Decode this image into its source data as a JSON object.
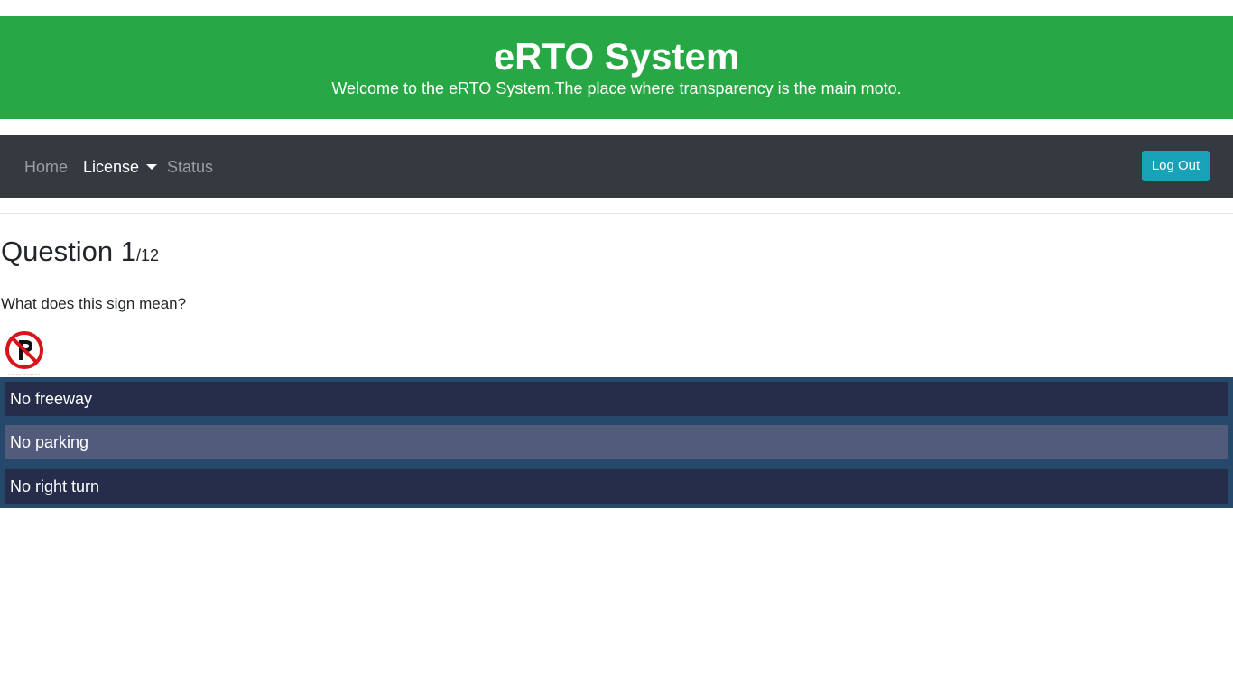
{
  "banner": {
    "title": "eRTO System",
    "subtitle": "Welcome to the eRTO System.The place where transparency is the main moto.",
    "background_color": "#28a745"
  },
  "navbar": {
    "items": [
      {
        "label": "Home"
      },
      {
        "label": "License",
        "has_dropdown": true,
        "active": true
      },
      {
        "label": "Status"
      }
    ],
    "logout_label": "Log Out",
    "background_color": "#343a40",
    "logout_color": "#17a2b8"
  },
  "question": {
    "label": "Question 1",
    "total": "/12",
    "text": "What does this sign mean?",
    "sign_icon": "no-parking-sign-icon"
  },
  "options": [
    {
      "label": "No freeway",
      "selected": false
    },
    {
      "label": "No parking",
      "selected": true
    },
    {
      "label": "No right turn",
      "selected": false
    }
  ],
  "colors": {
    "options_panel": "#26486b",
    "option_default": "#252d4a",
    "option_selected": "#525b7a"
  }
}
